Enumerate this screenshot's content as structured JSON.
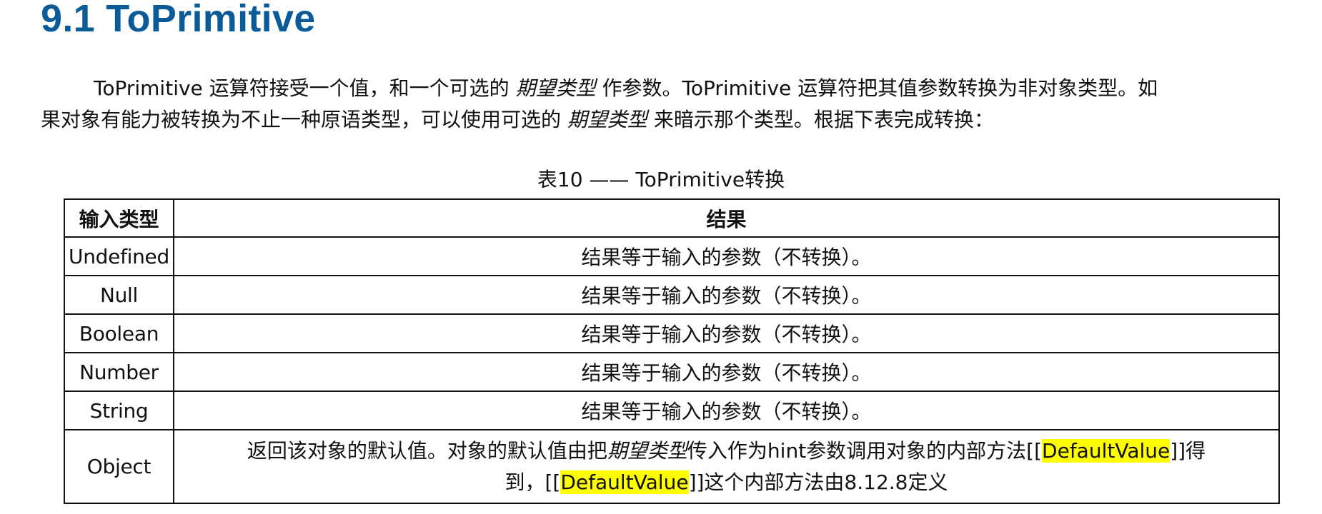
{
  "heading": {
    "title": "9.1 ToPrimitive"
  },
  "intro": {
    "line1": {
      "a": "ToPrimitive 运算符接受一个值，和一个可选的 ",
      "em1": "期望类型",
      "b": " 作参数。ToPrimitive 运算符把其值参数转换为非对象类型。如"
    },
    "line2": {
      "a": "果对象有能力被转换为不止一种原语类型，可以使用可选的 ",
      "em2": "期望类型",
      "b": " 来暗示那个类型。根据下表完成转换："
    }
  },
  "table": {
    "caption": "表10 —— ToPrimitive转换",
    "headers": [
      "输入类型",
      "结果"
    ],
    "rows": [
      {
        "type": "Undefined",
        "result": "结果等于输入的参数（不转换）。"
      },
      {
        "type": "Null",
        "result": "结果等于输入的参数（不转换）。"
      },
      {
        "type": "Boolean",
        "result": "结果等于输入的参数（不转换）。"
      },
      {
        "type": "Number",
        "result": "结果等于输入的参数（不转换）。"
      },
      {
        "type": "String",
        "result": "结果等于输入的参数（不转换）。"
      }
    ],
    "object_row": {
      "type": "Object",
      "seg1": "返回该对象的默认值。对象的默认值由把",
      "em": "期望类型",
      "seg2": "传入作为hint参数调用对象的内部方法[[",
      "hl1": "DefaultValue",
      "seg3": "]]得",
      "seg4": "到，[[",
      "hl2": "DefaultValue",
      "seg5": "]]这个内部方法由8.12.8定义"
    }
  },
  "colors": {
    "heading": "#0b5b98",
    "text": "#111111",
    "highlight": "#ffff00",
    "border": "#111111"
  }
}
